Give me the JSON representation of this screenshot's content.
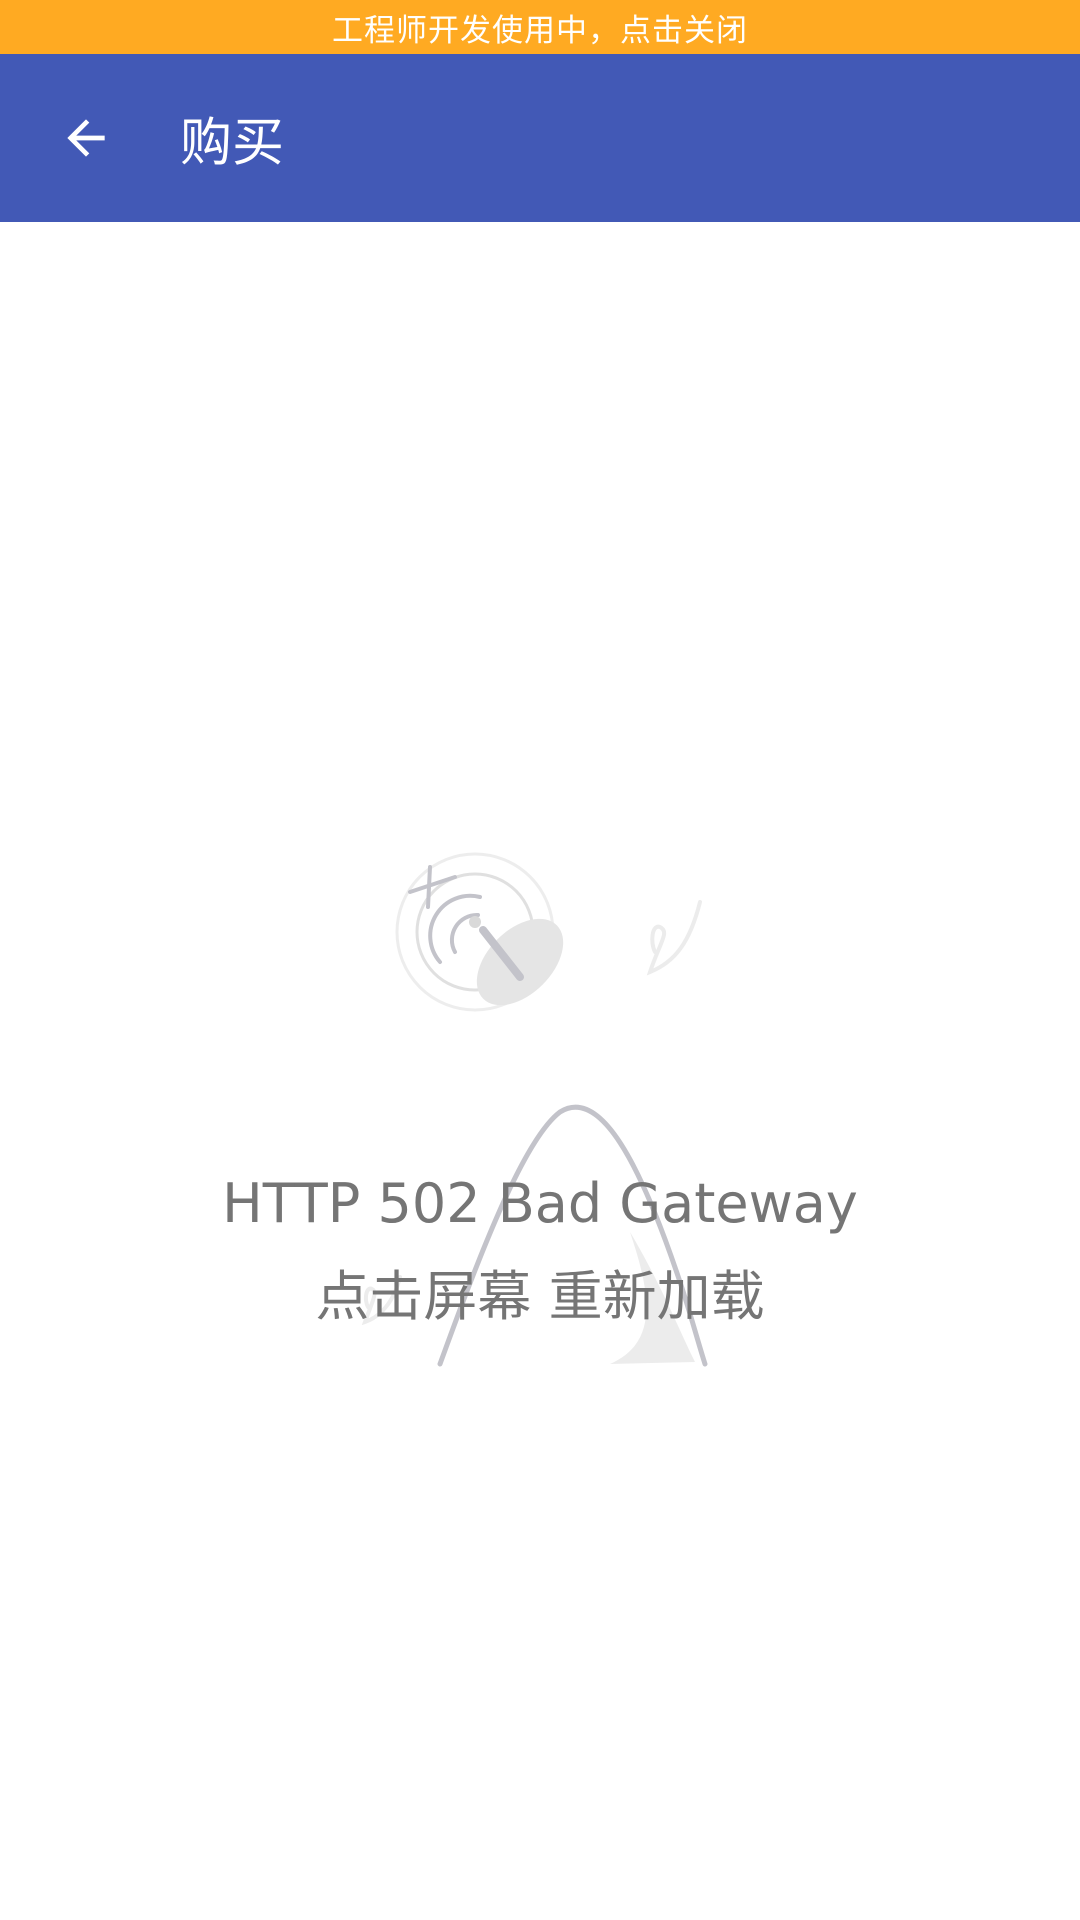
{
  "colors": {
    "banner_bg": "#FFAA22",
    "appbar_bg": "#4259B6",
    "text_gray": "#757575",
    "illustration_gray": "#C3C3CA",
    "illustration_light": "#ECECEC"
  },
  "banner": {
    "text": "工程师开发使用中，点击关闭"
  },
  "appbar": {
    "back_icon": "arrow-back-icon",
    "title": "购买"
  },
  "error": {
    "illustration_icon": "satellite-dish-no-signal-icon",
    "message": "HTTP 502 Bad Gateway",
    "hint": "点击屏幕 重新加载"
  }
}
